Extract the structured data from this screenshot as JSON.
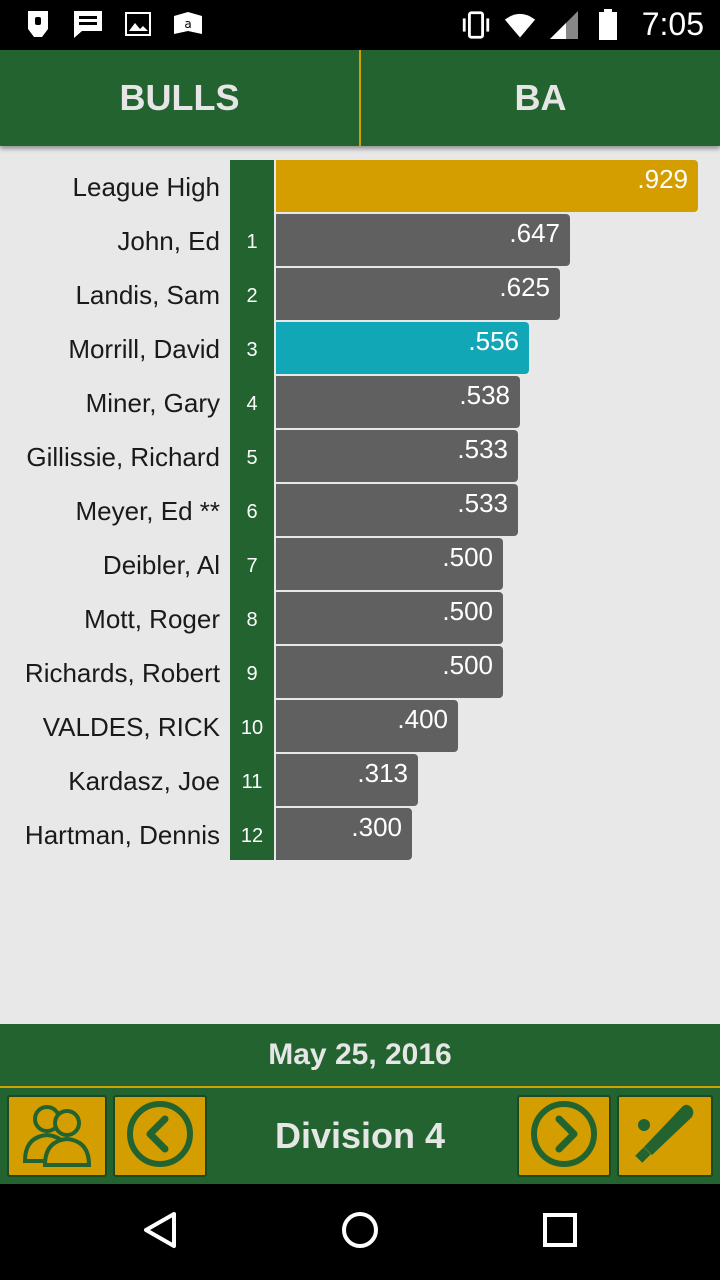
{
  "status_bar": {
    "time": "7:05",
    "left_icons": [
      "notification-icon",
      "message-icon",
      "image-icon",
      "amazon-icon"
    ],
    "right_icons": [
      "vibrate-icon",
      "wifi-icon",
      "signal-icon",
      "battery-icon"
    ]
  },
  "header": {
    "team_tab": "BULLS",
    "stat_tab": "BA"
  },
  "chart_data": {
    "type": "bar",
    "orientation": "horizontal",
    "xlim": [
      0,
      0.929
    ],
    "rows": [
      {
        "name": "League High",
        "rank": "",
        "value": 0.929,
        "label": ".929",
        "style": "high"
      },
      {
        "name": "John, Ed",
        "rank": "1",
        "value": 0.647,
        "label": ".647",
        "style": "normal"
      },
      {
        "name": "Landis, Sam",
        "rank": "2",
        "value": 0.625,
        "label": ".625",
        "style": "normal"
      },
      {
        "name": "Morrill, David",
        "rank": "3",
        "value": 0.556,
        "label": ".556",
        "style": "selected"
      },
      {
        "name": "Miner, Gary",
        "rank": "4",
        "value": 0.538,
        "label": ".538",
        "style": "normal"
      },
      {
        "name": "Gillissie, Richard",
        "rank": "5",
        "value": 0.533,
        "label": ".533",
        "style": "normal"
      },
      {
        "name": "Meyer, Ed **",
        "rank": "6",
        "value": 0.533,
        "label": ".533",
        "style": "normal"
      },
      {
        "name": "Deibler, Al",
        "rank": "7",
        "value": 0.5,
        "label": ".500",
        "style": "normal"
      },
      {
        "name": "Mott, Roger",
        "rank": "8",
        "value": 0.5,
        "label": ".500",
        "style": "normal"
      },
      {
        "name": "Richards, Robert",
        "rank": "9",
        "value": 0.5,
        "label": ".500",
        "style": "normal"
      },
      {
        "name": "VALDES, RICK",
        "rank": "10",
        "value": 0.4,
        "label": ".400",
        "style": "normal"
      },
      {
        "name": "Kardasz, Joe",
        "rank": "11",
        "value": 0.313,
        "label": ".313",
        "style": "normal"
      },
      {
        "name": "Hartman, Dennis",
        "rank": "12",
        "value": 0.3,
        "label": ".300",
        "style": "normal"
      }
    ]
  },
  "colors": {
    "primary_green": "#22632f",
    "gold": "#d49d00",
    "bar_gray": "#606060",
    "highlight_teal": "#12a7b7"
  },
  "footer": {
    "date": "May 25, 2016",
    "division": "Division 4",
    "buttons": [
      "players-icon",
      "previous-icon",
      "next-icon",
      "baseball-bat-icon"
    ]
  }
}
